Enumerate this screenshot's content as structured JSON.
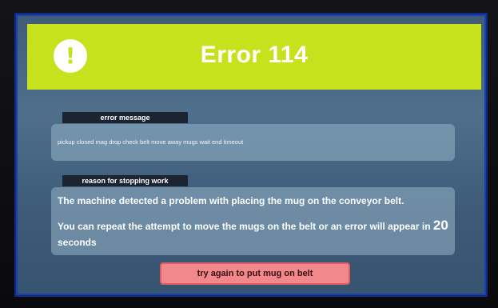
{
  "header": {
    "title": "Error 114",
    "alert_icon": "exclamation-circle-icon",
    "alert_glyph": "!",
    "color": "#c6e21c"
  },
  "error_message": {
    "tag": "error message",
    "text": "pickup closed mag drop check belt move away mugs wait end timeout"
  },
  "reason": {
    "tag": "reason for stopping work",
    "line1": "The machine detected a problem with placing the mug on the conveyor belt.",
    "line2_prefix": "You can repeat the attempt to move the mugs on the belt or an error will appear in",
    "countdown": "20",
    "line3": "seconds"
  },
  "action": {
    "retry_label": "try again to put mug on belt",
    "color": "#f0888c"
  }
}
